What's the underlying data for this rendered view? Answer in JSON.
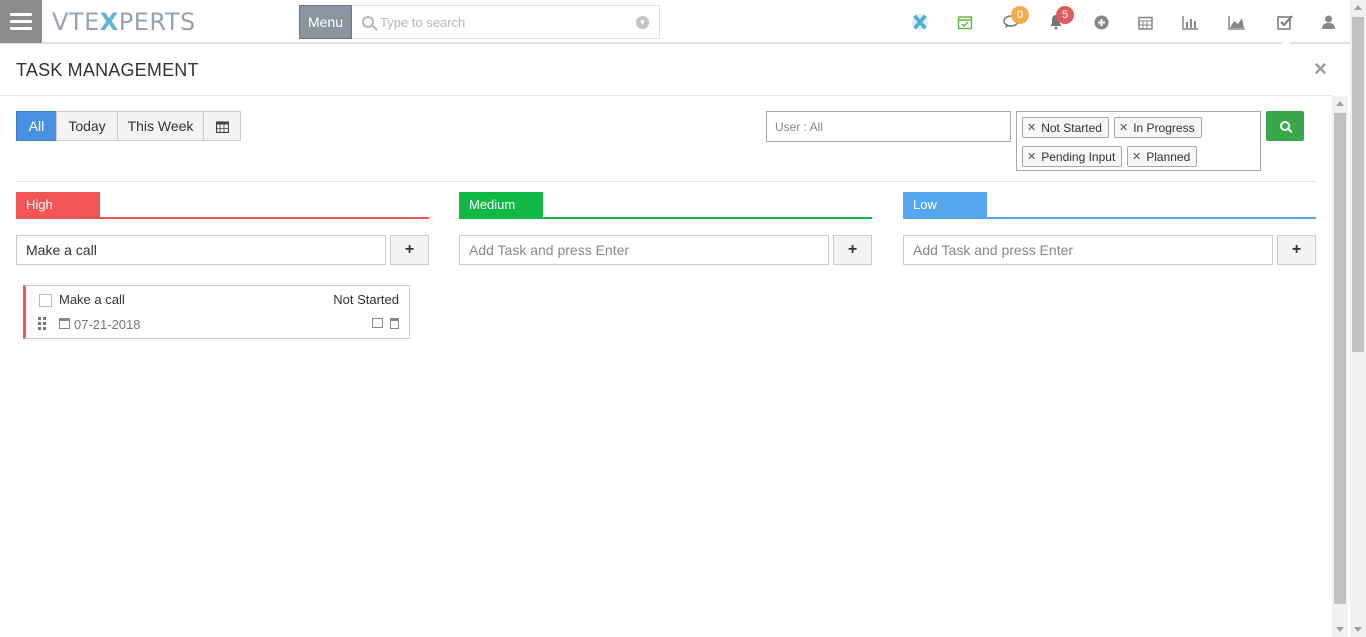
{
  "header": {
    "logo_left": "VTE",
    "logo_x": "X",
    "logo_right": "PERTS",
    "menu_label": "Menu",
    "search_placeholder": "Type to search",
    "icons": [
      "vtexperts-x-icon",
      "calendar-check-icon",
      "chat-icon",
      "bell-icon",
      "plus-circle-icon",
      "calendar-icon",
      "bar-chart-icon",
      "area-chart-icon",
      "tasks-icon",
      "user-icon"
    ],
    "chat_badge": "0",
    "bell_badge": "5",
    "chat_badge_color": "#f0ad4e",
    "bell_badge_color": "#e05d5d"
  },
  "modal": {
    "title": "TASK MANAGEMENT",
    "close": "×"
  },
  "filters": {
    "range_buttons": [
      "All",
      "Today",
      "This Week"
    ],
    "active": "All",
    "user_filter": "User : All",
    "status_chips": [
      "Not Started",
      "In Progress",
      "Pending Input",
      "Planned"
    ]
  },
  "columns": [
    {
      "label": "High",
      "color": "#f25555",
      "input_value": "Make a call",
      "input_placeholder": "Add Task and press Enter"
    },
    {
      "label": "Medium",
      "color": "#10b946",
      "input_value": "",
      "input_placeholder": "Add Task and press Enter"
    },
    {
      "label": "Low",
      "color": "#55a7f0",
      "input_value": "",
      "input_placeholder": "Add Task and press Enter"
    }
  ],
  "add_button": "+",
  "tasks": [
    {
      "title": "Make a call",
      "status": "Not Started",
      "date": "07-21-2018",
      "priority": "High"
    }
  ]
}
